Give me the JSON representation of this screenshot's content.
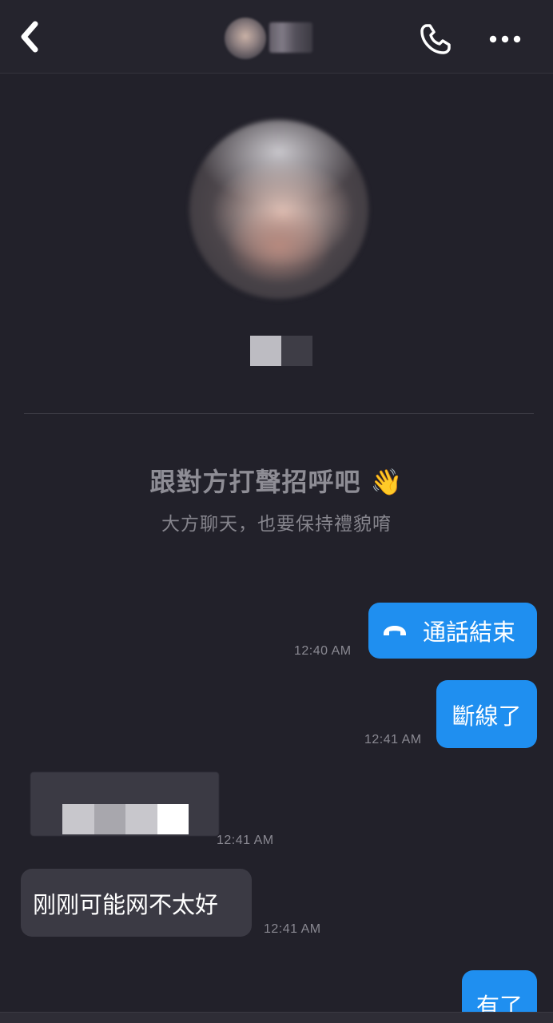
{
  "header": {
    "back_icon": "chevron-left-icon",
    "call_icon": "phone-icon",
    "more_icon": "more-horizontal-icon"
  },
  "intro": {
    "title": "跟對方打聲招呼吧 👋",
    "subtitle": "大方聊天，也要保持禮貌唷"
  },
  "messages": [
    {
      "direction": "out",
      "type": "call",
      "icon": "hang-up-icon",
      "text": "通話結束",
      "time": "12:40 AM"
    },
    {
      "direction": "out",
      "type": "text",
      "text": "斷線了",
      "time": "12:41 AM"
    },
    {
      "direction": "in",
      "type": "text",
      "text": "",
      "time": "12:41 AM"
    },
    {
      "direction": "in",
      "type": "text",
      "text": "刚刚可能网不太好",
      "time": "12:41 AM"
    },
    {
      "direction": "out",
      "type": "text",
      "text": "有了",
      "time": ""
    }
  ],
  "colors": {
    "background": "#22212a",
    "outgoing_bubble": "#1f8ff0",
    "incoming_bubble": "#3b3a44"
  }
}
